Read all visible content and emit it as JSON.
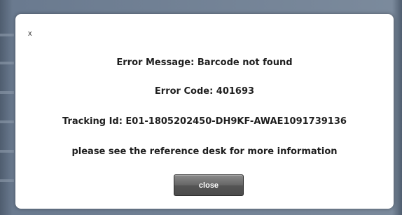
{
  "dialog": {
    "close_x": "x",
    "error_message_line": "Error Message: Barcode not found",
    "error_code_line": "Error Code: 401693",
    "tracking_id_line": "Tracking Id: E01-1805202450-DH9KF-AWAE1091739136",
    "info_line": "please see the reference desk for more information",
    "close_button_label": "close"
  },
  "colors": {
    "backdrop": "#5d6d80",
    "dialog_background": "#ffffff",
    "button_background": "#5a5a5a",
    "text": "#1f1f1f"
  }
}
